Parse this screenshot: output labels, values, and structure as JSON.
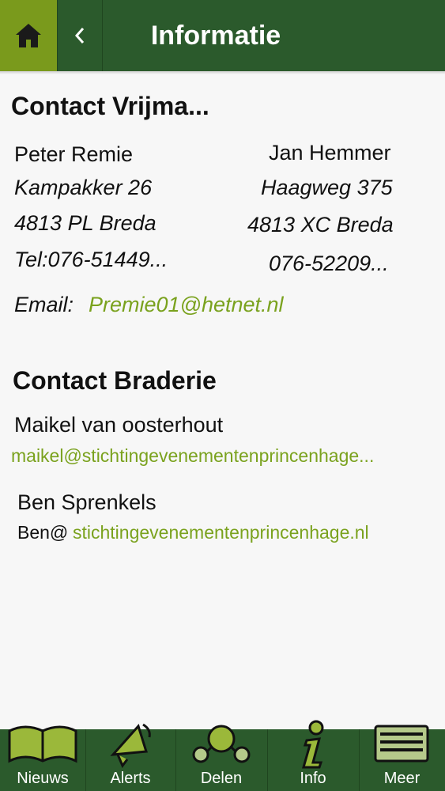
{
  "header": {
    "title": "Informatie"
  },
  "contact_vrijmarkt": {
    "heading": "Contact Vrijma...",
    "person1": {
      "name": "Peter Remie",
      "street": "Kampakker 26",
      "city": "4813 PL Breda",
      "tel": "Tel:076-51449..."
    },
    "person2": {
      "name": "Jan Hemmer",
      "street": "Haagweg 375",
      "city": "4813 XC Breda",
      "tel": "076-52209..."
    },
    "email_label": "Email:",
    "email": "Premie01@hetnet.nl"
  },
  "contact_braderie": {
    "heading": "Contact Braderie",
    "person1": {
      "name": "Maikel van oosterhout",
      "email": "maikel@stichtingevenementenprincenhage..."
    },
    "person2": {
      "name": "Ben Sprenkels",
      "email_prefix": "Ben@",
      "email_link": "stichtingevenementenprincenhage.nl"
    }
  },
  "tabs": [
    {
      "label": "Nieuws",
      "icon": "book-icon"
    },
    {
      "label": "Alerts",
      "icon": "megaphone-icon"
    },
    {
      "label": "Delen",
      "icon": "share-icon"
    },
    {
      "label": "Info",
      "icon": "info-icon"
    },
    {
      "label": "Meer",
      "icon": "stack-icon"
    }
  ],
  "colors": {
    "header": "#2b5a2c",
    "accent": "#7a9a1c",
    "link": "#7aa21e"
  }
}
